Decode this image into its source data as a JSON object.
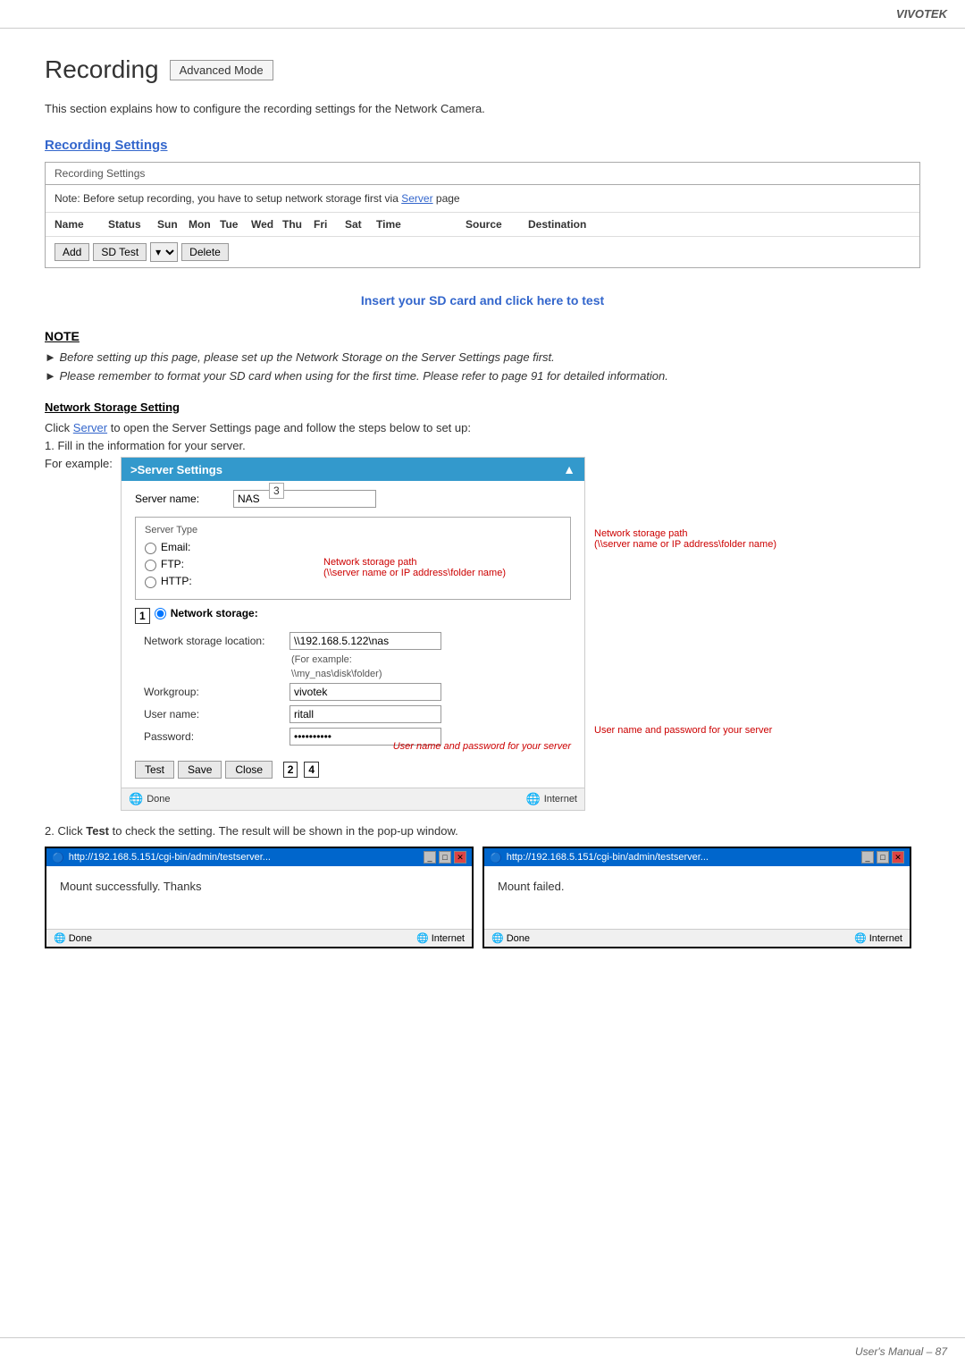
{
  "brand": "VIVOTEK",
  "page": {
    "title": "Recording",
    "advanced_mode_label": "Advanced Mode",
    "intro_text": "This section explains how to configure the recording settings for the Network Camera."
  },
  "recording_settings": {
    "section_title": "Recording Settings",
    "box_title": "Recording Settings",
    "note_text": "Note: Before setup recording, you have to setup network storage first via",
    "server_link": "Server",
    "server_link_suffix": " page",
    "table_headers": {
      "name": "Name",
      "status": "Status",
      "sun": "Sun",
      "mon": "Mon",
      "tue": "Tue",
      "wed": "Wed",
      "thu": "Thu",
      "fri": "Fri",
      "sat": "Sat",
      "time": "Time",
      "source": "Source",
      "destination": "Destination"
    },
    "buttons": {
      "add": "Add",
      "sd_test": "SD Test",
      "delete": "Delete"
    },
    "insert_sd_text": "Insert your SD card and click here to test"
  },
  "note_section": {
    "title": "NOTE",
    "items": [
      "Before setting up this page, please set up the Network Storage on the Server Settings page first.",
      "Please remember to format your SD card when using for the first time. Please refer to page 91 for detailed information."
    ]
  },
  "network_storage": {
    "title": "Network Storage Setting",
    "description": "Click",
    "server_link": "Server",
    "description2": " to open the Server Settings page and follow the steps below to set up:",
    "step1": "1. Fill in the information for your server.",
    "for_example": "For example:",
    "server_settings_panel": {
      "title": ">Server Settings",
      "server_name_label": "Server name:",
      "server_name_value": "NAS",
      "server_type_title": "Server Type",
      "radio_options": {
        "email": "Email:",
        "ftp": "FTP:",
        "http": "HTTP:"
      },
      "network_storage_label": "Network storage:",
      "network_storage_location_label": "Network storage location:",
      "network_storage_location_value": "\\\\192.168.5.122\\nas",
      "for_example_label": "(For example:",
      "example_path": "\\\\my_nas\\disk\\folder)",
      "workgroup_label": "Workgroup:",
      "workgroup_value": "vivotek",
      "username_label": "User name:",
      "username_value": "ritall",
      "password_label": "Password:",
      "password_value": "••••••••••",
      "path_annotation": "Network storage path\n(\\\\server name or IP address\\folder name)",
      "username_annotation": "User name and password for your server",
      "buttons": {
        "test": "Test",
        "save": "Save",
        "close": "Close"
      },
      "number_labels": {
        "n1": "1",
        "n2": "2",
        "n3": "3",
        "n4": "4"
      },
      "done": "Done",
      "internet": "Internet"
    }
  },
  "step2": {
    "text": "2. Click",
    "bold": "Test",
    "text2": " to check the setting. The result will be shown in the pop-up window."
  },
  "popup_success": {
    "title": "http://192.168.5.151/cgi-bin/admin/testserver...",
    "body": "Mount successfully. Thanks",
    "done": "Done",
    "internet": "Internet"
  },
  "popup_fail": {
    "title": "http://192.168.5.151/cgi-bin/admin/testserver...",
    "body": "Mount failed.",
    "done": "Done",
    "internet": "Internet"
  },
  "footer": {
    "text": "User's Manual – 87"
  }
}
